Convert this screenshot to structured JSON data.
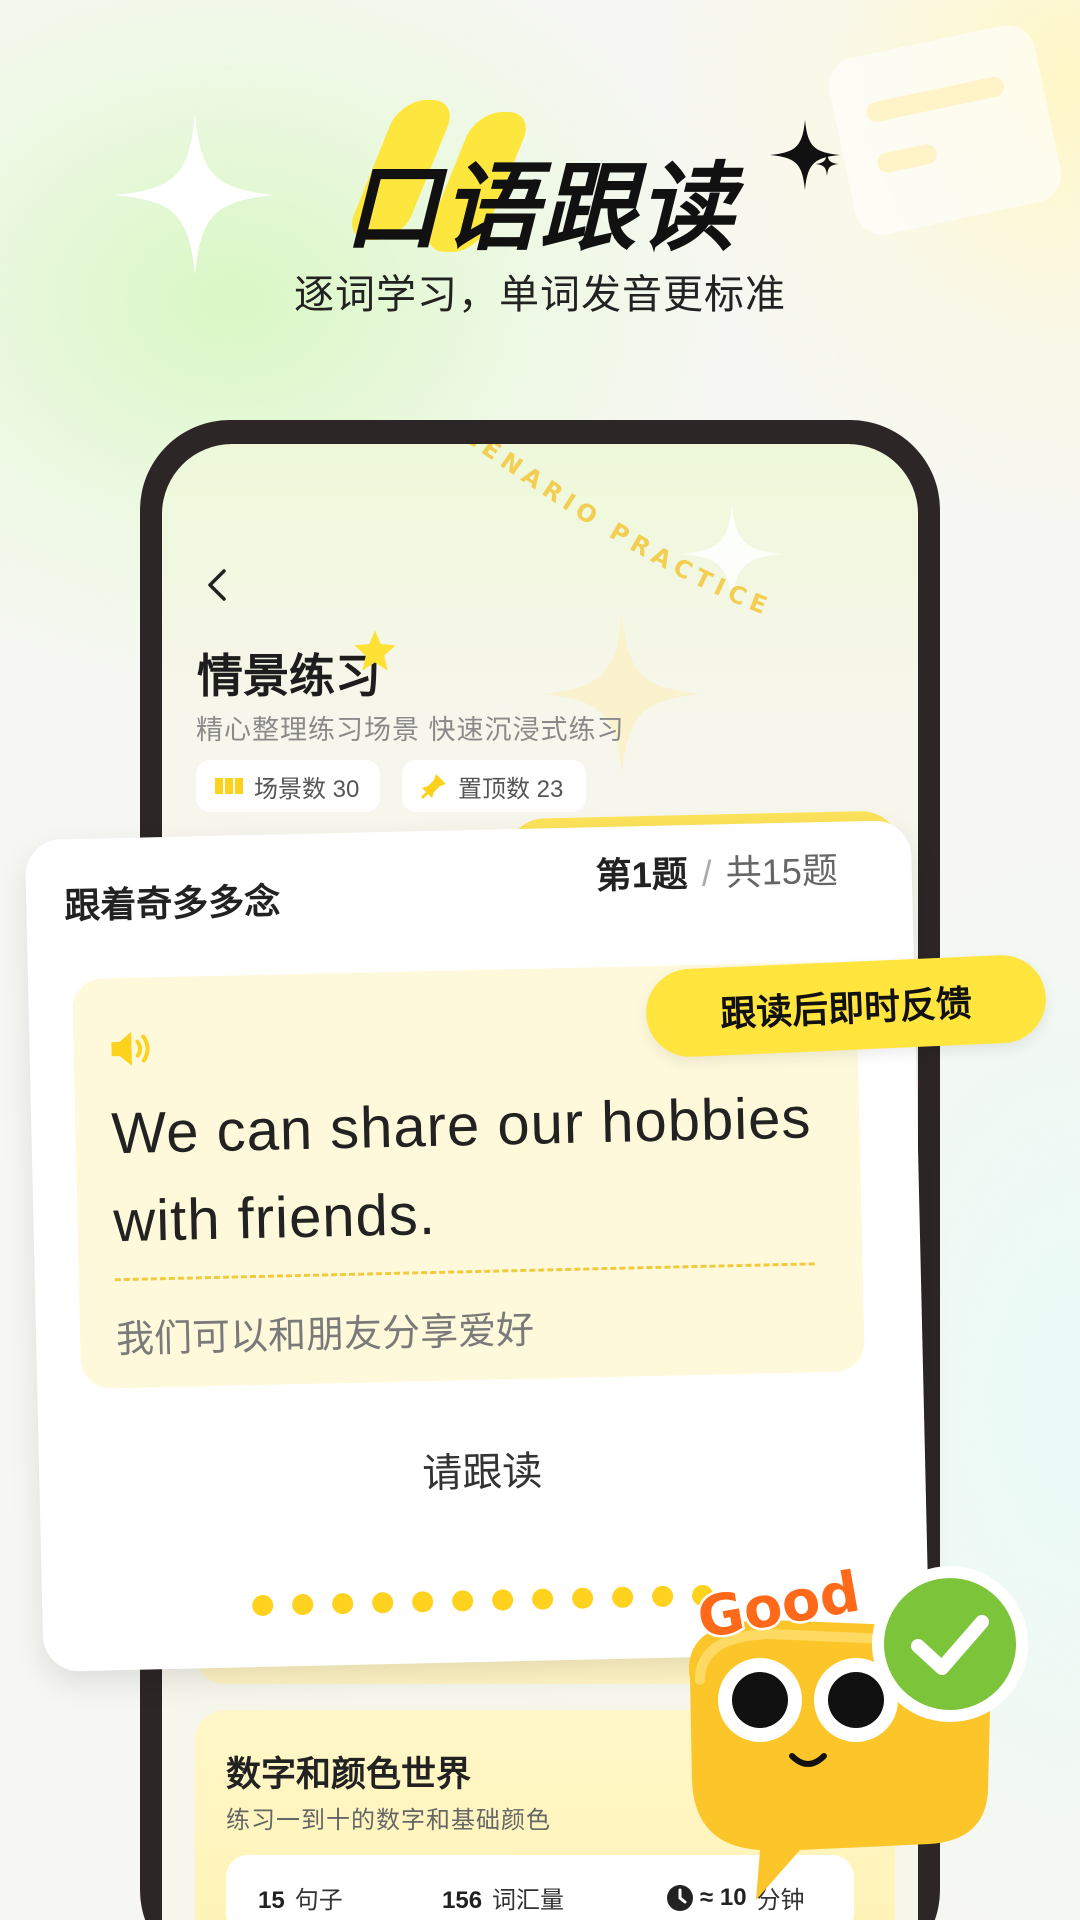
{
  "header": {
    "title": "口语跟读",
    "subtitle": "逐词学习，单词发音更标准"
  },
  "screen": {
    "deco_text": "SCENARIO PRACTICE SCENARIO P",
    "title": "情景练习",
    "subtitle": "精心整理练习场景 快速沉浸式练习",
    "pills": [
      {
        "icon": "book-icon",
        "label": "场景数 30"
      },
      {
        "icon": "pin-icon",
        "label": "置顶数 23"
      }
    ]
  },
  "practice_card": {
    "heading": "跟着奇多多念",
    "question_current": "第1题",
    "question_sep": "/",
    "question_total": "共15题",
    "sentence_en": "We can share our hobbies with friends.",
    "sentence_zh": "我们可以和朋友分享爱好",
    "prompt": "请跟读",
    "dot_count": 12
  },
  "feedback_badge": "跟读后即时反馈",
  "mascot": {
    "speech": "Good"
  },
  "topic_card": {
    "title": "数字和颜色世界",
    "subtitle": "练习一到十的数字和基础颜色",
    "stats": [
      {
        "value": "15",
        "label": "句子"
      },
      {
        "value": "156",
        "label": "词汇量"
      },
      {
        "value": "≈ 10",
        "label": "分钟"
      }
    ]
  },
  "colors": {
    "accent_yellow": "#fde35a",
    "check_green": "#7cc43a"
  }
}
